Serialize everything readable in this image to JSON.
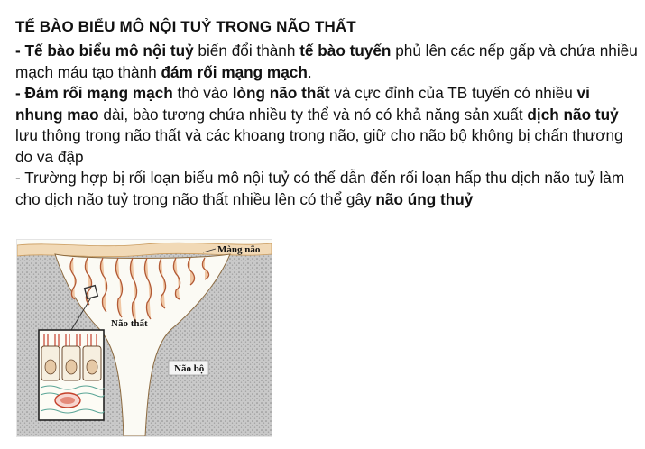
{
  "title": "TẾ BÀO BIỂU MÔ NỘI TUỶ TRONG NÃO THẤT",
  "paragraphs": [
    {
      "runs": [
        {
          "text": "- Tế bào biểu mô nội tuỷ",
          "bold": true
        },
        {
          "text": " biến đổi thành ",
          "bold": false
        },
        {
          "text": "tế bào tuyến",
          "bold": true
        },
        {
          "text": " phủ lên các nếp gấp và chứa nhiều mạch máu tạo thành ",
          "bold": false
        },
        {
          "text": "đám rối mạng mạch",
          "bold": true
        },
        {
          "text": ".",
          "bold": false
        }
      ]
    },
    {
      "runs": [
        {
          "text": "- Đám rối mạng mạch",
          "bold": true
        },
        {
          "text": " thò vào ",
          "bold": false
        },
        {
          "text": "lòng não thất",
          "bold": true
        },
        {
          "text": " và cực đỉnh của TB tuyến có nhiều ",
          "bold": false
        },
        {
          "text": "vi nhung mao",
          "bold": true
        },
        {
          "text": " dài, bào tương chứa nhiều ty thể và nó có khả năng sản xuất ",
          "bold": false
        },
        {
          "text": "dịch não tuỷ",
          "bold": true
        },
        {
          "text": " lưu thông trong não thất và các khoang trong não, giữ cho não bộ không bị chấn thương do va đập",
          "bold": false
        }
      ]
    },
    {
      "runs": [
        {
          "text": "- Trường hợp bị rối loạn biểu mô nội tuỷ có thể dẫn đến rối loạn hấp thu dịch não tuỷ làm cho dịch não tuỷ trong não thất nhiều lên có thể gây ",
          "bold": false
        },
        {
          "text": "não úng thuỷ",
          "bold": true
        }
      ]
    }
  ],
  "figure": {
    "labels": {
      "meninges": "Màng não",
      "ventricle": "Não thất",
      "brain": "Não bộ"
    }
  }
}
